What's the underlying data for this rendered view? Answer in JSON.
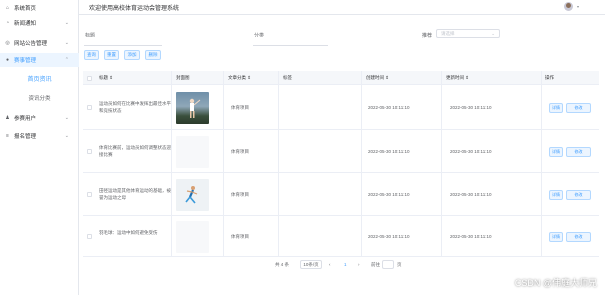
{
  "header": {
    "title": "欢迎使用高校体育运动会管理系统"
  },
  "sidebar": {
    "items": [
      {
        "label": "系统首页",
        "icon": "home-icon"
      },
      {
        "label": "新闻通知",
        "icon": "bell-icon"
      },
      {
        "label": "网站公告管理",
        "icon": "megaphone-icon"
      },
      {
        "label": "赛事管理",
        "icon": "location-icon"
      },
      {
        "label": "首页资讯",
        "icon": ""
      },
      {
        "label": "资讯分类",
        "icon": ""
      },
      {
        "label": "参赛用户",
        "icon": "user-icon"
      },
      {
        "label": "报名管理",
        "icon": "list-icon"
      }
    ]
  },
  "filters": {
    "title_label": "标题",
    "category_label": "分类",
    "recommend_label": "推荐",
    "recommend_placeholder": "请选择"
  },
  "buttons": {
    "search": "查询",
    "reset": "重置",
    "add": "添加",
    "delete": "删除"
  },
  "table": {
    "columns": [
      "标题",
      "封面图",
      "文章分类",
      "标签",
      "创建时间",
      "更新时间",
      "操作"
    ],
    "rows": [
      {
        "title": "运动员如何在比赛中发挥出最佳水平和竞技状态",
        "category": "体育项目",
        "tag": "",
        "created": "2022-05-30 10:11:10",
        "updated": "2022-05-30 10:11:10",
        "thumb": "tennis"
      },
      {
        "title": "体育比赛前，运动员如何调整状态迎接比赛",
        "category": "体育项目",
        "tag": "",
        "created": "2022-05-30 10:11:10",
        "updated": "2022-05-30 10:11:10",
        "thumb": "blank"
      },
      {
        "title": "田径运动是其他体育运动的基础，被誉为运动之母",
        "category": "体育项目",
        "tag": "",
        "created": "2022-05-30 10:11:10",
        "updated": "2022-05-30 10:11:10",
        "thumb": "runner"
      },
      {
        "title": "羽毛球：运动中如何避免受伤",
        "category": "体育项目",
        "tag": "",
        "created": "2022-05-30 10:11:10",
        "updated": "2022-05-30 10:11:10",
        "thumb": "blank"
      }
    ],
    "row_actions": {
      "view": "详情",
      "edit": "修改"
    }
  },
  "pagination": {
    "total": "共 4 条",
    "page_size": "10条/页",
    "prev": "‹",
    "current": "1",
    "next": "›",
    "goto": "前往",
    "page_suffix": "页"
  },
  "watermark": "CSDN @伟庭大师兄",
  "colors": {
    "accent": "#409eff",
    "accent_bg": "#ecf5ff",
    "sidebar_active_bg": "#ecf5ff"
  }
}
